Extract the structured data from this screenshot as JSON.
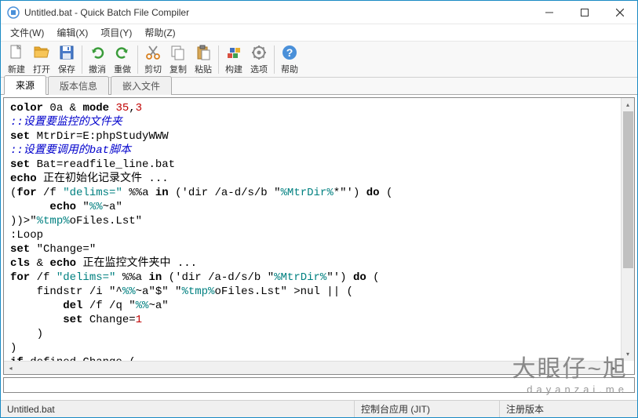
{
  "window": {
    "title": "Untitled.bat - Quick Batch File Compiler"
  },
  "menus": [
    {
      "label": "文件(W)"
    },
    {
      "label": "编辑(X)"
    },
    {
      "label": "项目(Y)"
    },
    {
      "label": "帮助(Z)"
    }
  ],
  "toolbar": [
    {
      "name": "new",
      "label": "新建",
      "icon": "new-file-icon"
    },
    {
      "name": "open",
      "label": "打开",
      "icon": "open-folder-icon"
    },
    {
      "name": "save",
      "label": "保存",
      "icon": "save-icon"
    },
    {
      "sep": true
    },
    {
      "name": "undo",
      "label": "撤消",
      "icon": "undo-icon"
    },
    {
      "name": "redo",
      "label": "重做",
      "icon": "redo-icon"
    },
    {
      "sep": true
    },
    {
      "name": "cut",
      "label": "剪切",
      "icon": "cut-icon"
    },
    {
      "name": "copy",
      "label": "复制",
      "icon": "copy-icon"
    },
    {
      "name": "paste",
      "label": "粘贴",
      "icon": "paste-icon"
    },
    {
      "sep": true
    },
    {
      "name": "build",
      "label": "构建",
      "icon": "build-icon"
    },
    {
      "name": "options",
      "label": "选项",
      "icon": "options-icon"
    },
    {
      "sep": true
    },
    {
      "name": "help",
      "label": "帮助",
      "icon": "help-icon"
    }
  ],
  "tabs": [
    {
      "label": "来源",
      "active": true
    },
    {
      "label": "版本信息",
      "active": false
    },
    {
      "label": "嵌入文件",
      "active": false
    }
  ],
  "code": {
    "lines": [
      {
        "segments": [
          {
            "t": "kw",
            "v": "color"
          },
          {
            "t": "",
            "v": " 0a & "
          },
          {
            "t": "kw",
            "v": "mode"
          },
          {
            "t": "",
            "v": " "
          },
          {
            "t": "num",
            "v": "35"
          },
          {
            "t": "",
            "v": ","
          },
          {
            "t": "num",
            "v": "3"
          }
        ]
      },
      {
        "segments": [
          {
            "t": "cmt",
            "v": "::设置要监控的文件夹"
          }
        ]
      },
      {
        "segments": [
          {
            "t": "kw",
            "v": "set"
          },
          {
            "t": "",
            "v": " MtrDir=E:phpStudyWWW"
          }
        ]
      },
      {
        "segments": [
          {
            "t": "cmt",
            "v": "::设置要调用的bat脚本"
          }
        ]
      },
      {
        "segments": [
          {
            "t": "kw",
            "v": "set"
          },
          {
            "t": "",
            "v": " Bat=readfile_line.bat"
          }
        ]
      },
      {
        "segments": [
          {
            "t": "kw",
            "v": "echo"
          },
          {
            "t": "",
            "v": " 正在初始化记录文件 ..."
          }
        ]
      },
      {
        "segments": [
          {
            "t": "",
            "v": "("
          },
          {
            "t": "kw",
            "v": "for"
          },
          {
            "t": "",
            "v": " /f "
          },
          {
            "t": "str",
            "v": "\"delims=\""
          },
          {
            "t": "",
            "v": " %%a "
          },
          {
            "t": "kw",
            "v": "in"
          },
          {
            "t": "",
            "v": " ('dir /a-d/s/b \""
          },
          {
            "t": "var",
            "v": "%MtrDir%"
          },
          {
            "t": "",
            "v": "*\"') "
          },
          {
            "t": "kw",
            "v": "do"
          },
          {
            "t": "",
            "v": " ("
          }
        ]
      },
      {
        "segments": [
          {
            "t": "",
            "v": "      "
          },
          {
            "t": "kw",
            "v": "echo"
          },
          {
            "t": "",
            "v": " \""
          },
          {
            "t": "var",
            "v": "%%"
          },
          {
            "t": "",
            "v": "~a\""
          }
        ]
      },
      {
        "segments": [
          {
            "t": "",
            "v": "))>\""
          },
          {
            "t": "var",
            "v": "%tmp%"
          },
          {
            "t": "",
            "v": "oFiles.Lst\""
          }
        ]
      },
      {
        "segments": [
          {
            "t": "",
            "v": ":Loop"
          }
        ]
      },
      {
        "segments": [
          {
            "t": "kw",
            "v": "set"
          },
          {
            "t": "",
            "v": " \"Change=\""
          }
        ]
      },
      {
        "segments": [
          {
            "t": "kw",
            "v": "cls"
          },
          {
            "t": "",
            "v": " & "
          },
          {
            "t": "kw",
            "v": "echo"
          },
          {
            "t": "",
            "v": " 正在监控文件夹中 ..."
          }
        ]
      },
      {
        "segments": [
          {
            "t": "kw",
            "v": "for"
          },
          {
            "t": "",
            "v": " /f "
          },
          {
            "t": "str",
            "v": "\"delims=\""
          },
          {
            "t": "",
            "v": " %%a "
          },
          {
            "t": "kw",
            "v": "in"
          },
          {
            "t": "",
            "v": " ('dir /a-d/s/b \""
          },
          {
            "t": "var",
            "v": "%MtrDir%"
          },
          {
            "t": "",
            "v": "\"') "
          },
          {
            "t": "kw",
            "v": "do"
          },
          {
            "t": "",
            "v": " ("
          }
        ]
      },
      {
        "segments": [
          {
            "t": "",
            "v": "    findstr /i \"^"
          },
          {
            "t": "var",
            "v": "%%"
          },
          {
            "t": "",
            "v": "~a\"$\" \""
          },
          {
            "t": "var",
            "v": "%tmp%"
          },
          {
            "t": "",
            "v": "oFiles.Lst\" >nul || ("
          }
        ]
      },
      {
        "segments": [
          {
            "t": "",
            "v": "        "
          },
          {
            "t": "kw",
            "v": "del"
          },
          {
            "t": "",
            "v": " /f /q \""
          },
          {
            "t": "var",
            "v": "%%"
          },
          {
            "t": "",
            "v": "~a\""
          }
        ]
      },
      {
        "segments": [
          {
            "t": "",
            "v": "        "
          },
          {
            "t": "kw",
            "v": "set"
          },
          {
            "t": "",
            "v": " Change="
          },
          {
            "t": "num",
            "v": "1"
          }
        ]
      },
      {
        "segments": [
          {
            "t": "",
            "v": "    )"
          }
        ]
      },
      {
        "segments": [
          {
            "t": "",
            "v": ")"
          }
        ]
      },
      {
        "segments": [
          {
            "t": "kw",
            "v": "if"
          },
          {
            "t": "",
            "v": " defined Change ("
          }
        ]
      }
    ]
  },
  "status": {
    "file": "Untitled.bat",
    "mode": "控制台应用 (JIT)",
    "license": "注册版本"
  },
  "watermark": {
    "line1": "大眼仔~旭",
    "line2": "dayanzai.me"
  }
}
